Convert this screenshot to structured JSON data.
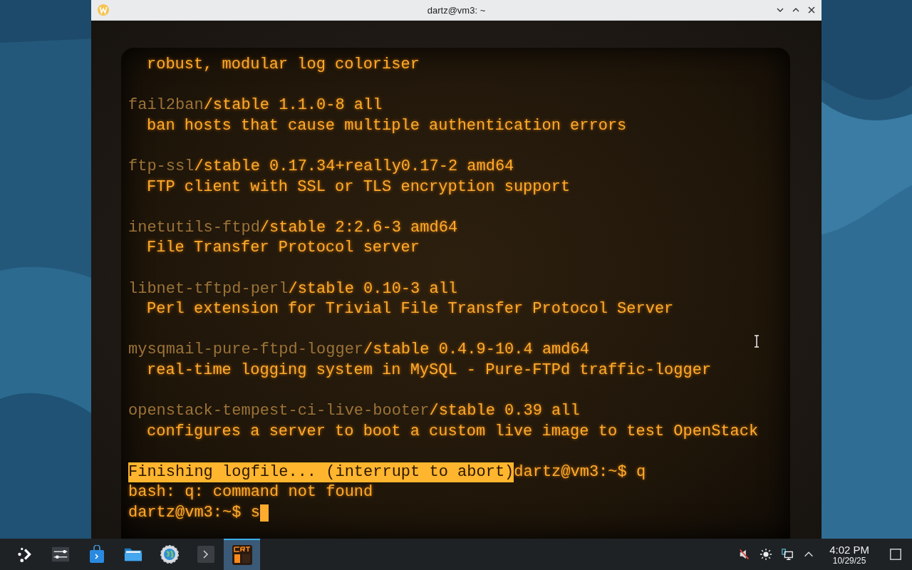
{
  "window": {
    "title": "dartz@vm3: ~"
  },
  "terminal": {
    "groups": [
      [
        {
          "kind": "description",
          "text": "robust, modular log coloriser"
        }
      ],
      [
        {
          "kind": "package",
          "name": "fail2ban",
          "info": "/stable 1.1.0-8 all"
        },
        {
          "kind": "description",
          "text": "ban hosts that cause multiple authentication errors"
        }
      ],
      [
        {
          "kind": "package",
          "name": "ftp-ssl",
          "info": "/stable 0.17.34+really0.17-2 amd64"
        },
        {
          "kind": "description",
          "text": "FTP client with SSL or TLS encryption support"
        }
      ],
      [
        {
          "kind": "package",
          "name": "inetutils-ftpd",
          "info": "/stable 2:2.6-3 amd64"
        },
        {
          "kind": "description",
          "text": "File Transfer Protocol server"
        }
      ],
      [
        {
          "kind": "package",
          "name": "libnet-tftpd-perl",
          "info": "/stable 0.10-3 all"
        },
        {
          "kind": "description",
          "text": "Perl extension for Trivial File Transfer Protocol Server"
        }
      ],
      [
        {
          "kind": "package",
          "name": "mysqmail-pure-ftpd-logger",
          "info": "/stable 0.4.9-10.4 amd64"
        },
        {
          "kind": "description",
          "text": "real-time logging system in MySQL - Pure-FTPd traffic-logger"
        }
      ],
      [
        {
          "kind": "package",
          "name": "openstack-tempest-ci-live-booter",
          "info": "/stable 0.39 all"
        },
        {
          "kind": "description",
          "text": "configures a server to boot a custom live image to test OpenStack"
        }
      ],
      [
        {
          "kind": "status",
          "highlight": "Finishing logfile... (interrupt to abort)",
          "text": "dartz@vm3:~$ q"
        },
        {
          "kind": "output",
          "text": "bash: q: command not found"
        },
        {
          "kind": "prompt",
          "text": "dartz@vm3:~$ s",
          "cursor": true
        }
      ]
    ]
  },
  "taskbar": {
    "items": [
      {
        "kind": "launcher",
        "selected": false
      },
      {
        "kind": "settings",
        "selected": false
      },
      {
        "kind": "store",
        "selected": false
      },
      {
        "kind": "files",
        "selected": false
      },
      {
        "kind": "browser",
        "selected": false
      },
      {
        "kind": "console",
        "selected": false
      },
      {
        "kind": "crt",
        "selected": true
      }
    ],
    "tray": {
      "time": "4:02 PM",
      "date": "10/29/25"
    }
  }
}
